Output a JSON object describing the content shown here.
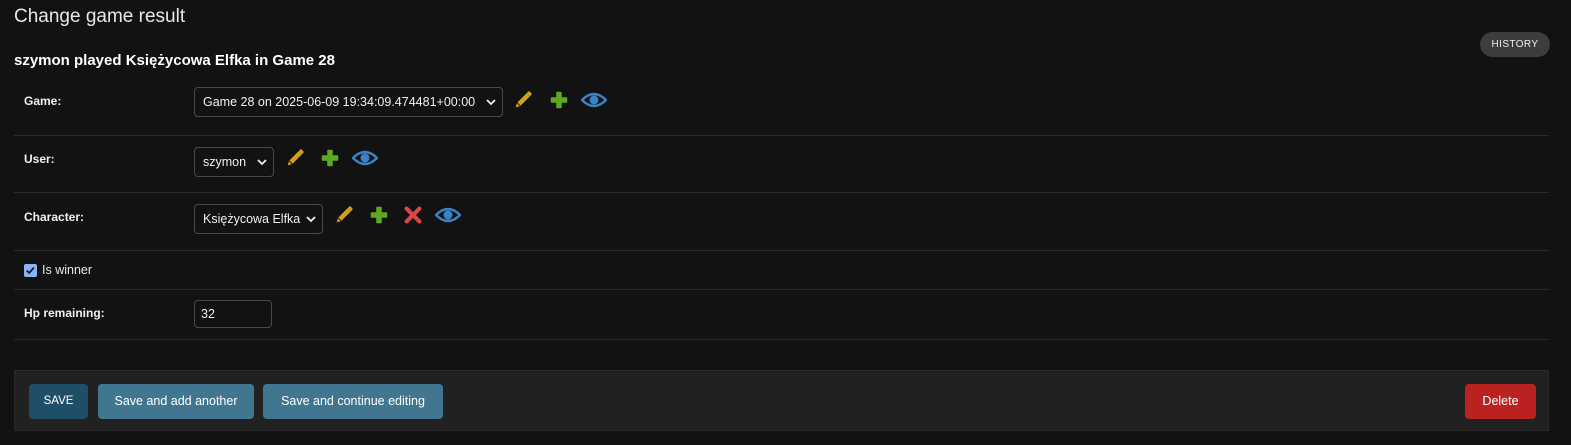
{
  "header": {
    "title": "Change game result",
    "object_title": "szymon played Księżycowa Elfka in Game 28",
    "history_label": "HISTORY"
  },
  "form": {
    "game": {
      "label": "Game:",
      "selected": "Game 28 on 2025-06-09 19:34:09.474481+00:00"
    },
    "user": {
      "label": "User:",
      "selected": "szymon"
    },
    "character": {
      "label": "Character:",
      "selected": "Księżycowa Elfka"
    },
    "is_winner": {
      "label": "Is winner",
      "checked": true
    },
    "hp_remaining": {
      "label": "Hp remaining:",
      "value": "32"
    }
  },
  "actions": {
    "save_label": "SAVE",
    "save_add_label": "Save and add another",
    "save_continue_label": "Save and continue editing",
    "delete_label": "Delete"
  },
  "icons": {
    "edit": "pencil-icon",
    "add": "plus-icon",
    "delete": "x-icon",
    "view": "eye-icon"
  },
  "colors": {
    "background": "#121212",
    "pencil": "#d4a017",
    "plus": "#5eaa1e",
    "x": "#dd4646",
    "eye": "#3b82c4",
    "save": "#1f4e69",
    "secondary_button": "#417690",
    "delete": "#ba2121"
  }
}
